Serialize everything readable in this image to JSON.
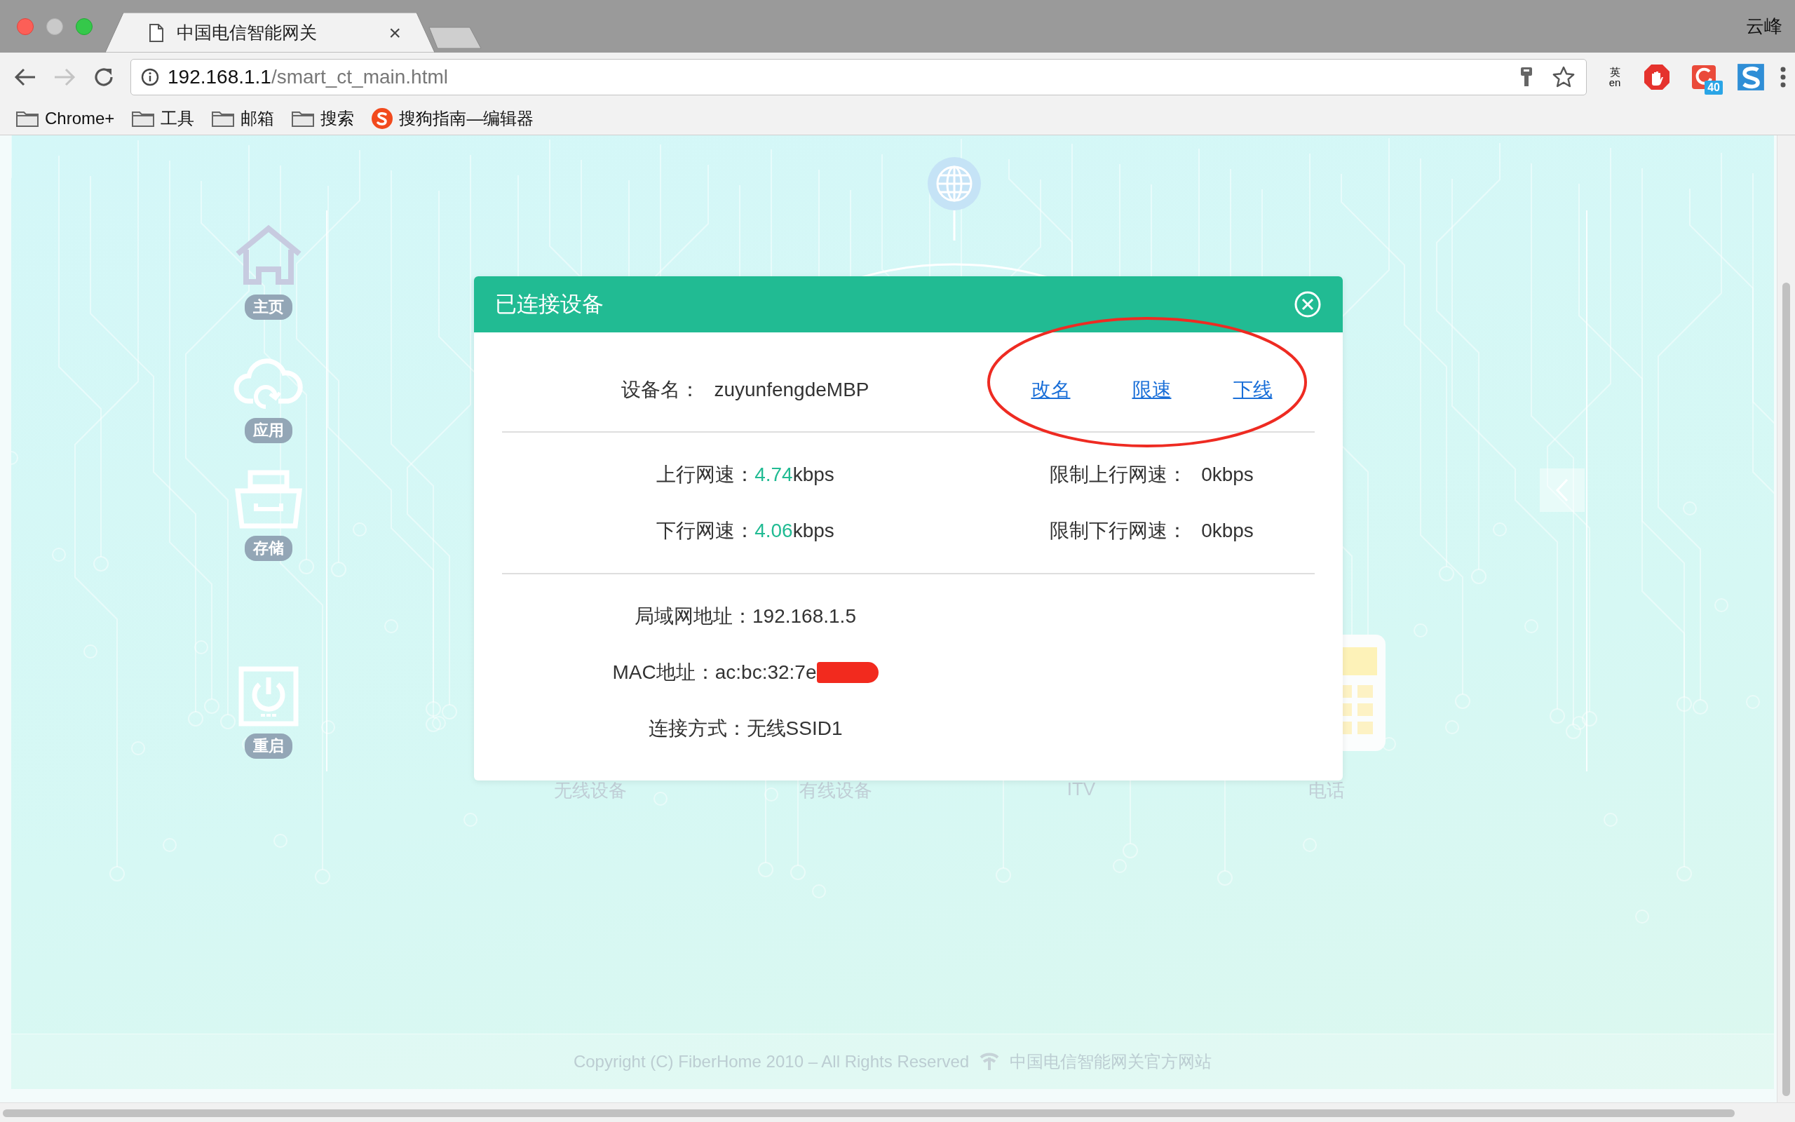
{
  "browser": {
    "tab": {
      "title": "中国电信智能网关",
      "close": "×"
    },
    "profile": "云峰",
    "nav": {
      "back_disabled": false,
      "forward_disabled": true
    },
    "address": {
      "host": "192.168.1.1",
      "path": "/smart_ct_main.html"
    },
    "extensions": [
      {
        "kind": "translate",
        "top": "英",
        "bottom": "en"
      },
      {
        "kind": "adblock"
      },
      {
        "kind": "badge",
        "badge": "40"
      },
      {
        "kind": "sogou"
      }
    ],
    "bookmarks": [
      {
        "kind": "folder",
        "label": "Chrome+"
      },
      {
        "kind": "folder",
        "label": "工具"
      },
      {
        "kind": "folder",
        "label": "邮箱"
      },
      {
        "kind": "folder",
        "label": "搜索"
      },
      {
        "kind": "sogou",
        "label": "搜狗指南—编辑器"
      }
    ]
  },
  "sidebar": {
    "items": [
      {
        "kind": "home",
        "label": "主页"
      },
      {
        "kind": "cloud",
        "label": "应用"
      },
      {
        "kind": "storage",
        "label": "存储"
      },
      {
        "kind": "power",
        "label": "重启"
      }
    ]
  },
  "device_categories": [
    "无线设备",
    "有线设备",
    "ITV",
    "电话"
  ],
  "dialog": {
    "title": "已连接设备",
    "device_name": {
      "label": "设备名：",
      "value": "zuyunfengdeMBP"
    },
    "actions": [
      "改名",
      "限速",
      "下线"
    ],
    "annotation": {
      "kind": "ellipse"
    },
    "speeds": [
      {
        "label": "上行网速：",
        "value": "4.74",
        "unit": "kbps",
        "limit_label": "限制上行网速：",
        "limit_value": "0kbps"
      },
      {
        "label": "下行网速：",
        "value": "4.06",
        "unit": "kbps",
        "limit_label": "限制下行网速：",
        "limit_value": "0kbps"
      }
    ],
    "info": [
      {
        "label": "局域网地址：",
        "value": "192.168.1.5",
        "redacted": false
      },
      {
        "label": "MAC地址：",
        "value": "ac:bc:32:7e",
        "redacted": true
      },
      {
        "label": "连接方式：",
        "value": "无线SSID1",
        "redacted": false
      }
    ]
  },
  "footer": {
    "copyright": "Copyright (C) FiberHome 2010 – All Rights Reserved",
    "link": "中国电信智能网关官方网站"
  }
}
